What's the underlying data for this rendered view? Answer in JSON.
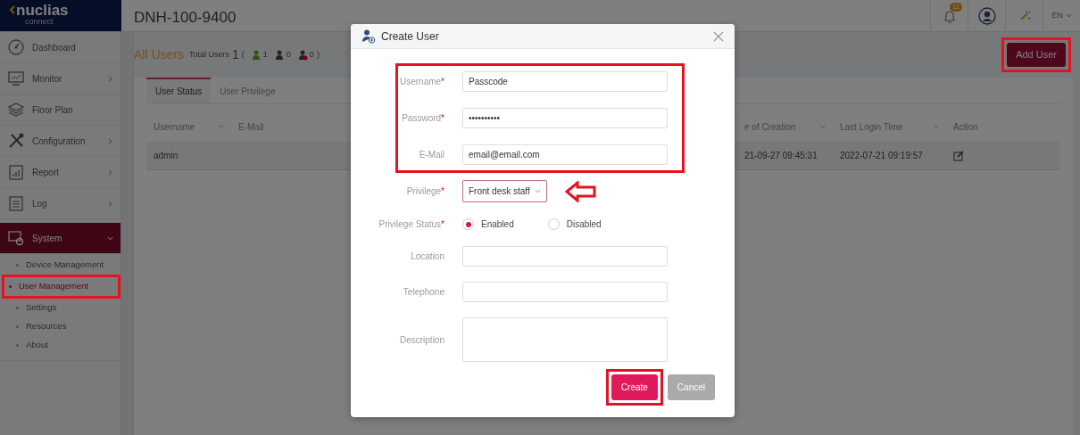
{
  "brand": {
    "name": "nuclias",
    "tagline": "connect"
  },
  "header": {
    "title": "DNH-100-9400",
    "notification_count": "11",
    "language": "EN"
  },
  "sidebar": {
    "items": [
      {
        "label": "Dashboard",
        "has_arrow": false,
        "expanded": false
      },
      {
        "label": "Monitor",
        "has_arrow": true,
        "expanded": false
      },
      {
        "label": "Floor Plan",
        "has_arrow": false,
        "expanded": false
      },
      {
        "label": "Configuration",
        "has_arrow": true,
        "expanded": false
      },
      {
        "label": "Report",
        "has_arrow": true,
        "expanded": false
      },
      {
        "label": "Log",
        "has_arrow": true,
        "expanded": false
      },
      {
        "label": "System",
        "has_arrow": true,
        "expanded": true,
        "children": [
          {
            "label": "Device Management",
            "selected": false,
            "highlighted": false
          },
          {
            "label": "User Management",
            "selected": true,
            "highlighted": true
          },
          {
            "label": "Settings",
            "selected": false,
            "highlighted": false
          },
          {
            "label": "Resources",
            "selected": false,
            "highlighted": false
          },
          {
            "label": "About",
            "selected": false,
            "highlighted": false
          }
        ]
      }
    ]
  },
  "page": {
    "title": "All Users",
    "total_label": "Total Users",
    "total": "1",
    "open_paren": "(",
    "close_paren": ")",
    "counts": [
      {
        "kind": "active",
        "value": "1"
      },
      {
        "kind": "inactive",
        "value": "0"
      },
      {
        "kind": "blocked",
        "value": "0"
      }
    ],
    "add_button": "Add User"
  },
  "tabs": [
    {
      "label": "User Status",
      "selected": true
    },
    {
      "label": "User Privilege",
      "selected": false
    }
  ],
  "table": {
    "columns": [
      {
        "label": "Username",
        "sortable": true
      },
      {
        "label": "E-Mail"
      },
      {
        "label": "e of Creation",
        "sortable": true
      },
      {
        "label": "Last Login Time",
        "sortable": true
      },
      {
        "label": "Action",
        "sortable": false
      }
    ],
    "rows": [
      {
        "cells": [
          "admin",
          "",
          "21-09-27 09:45:31",
          "2022-07-21 09:19:57"
        ]
      }
    ]
  },
  "modal": {
    "title": "Create User",
    "fields": [
      {
        "kind": "text",
        "label": "Username",
        "required_mark": "*",
        "value": "Passcode"
      },
      {
        "kind": "text",
        "label": "Password",
        "required_mark": "*",
        "value": "••••••••••"
      },
      {
        "kind": "text",
        "label": "E-Mail",
        "value": "email@email.com"
      },
      {
        "kind": "select",
        "label": "Privilege",
        "required_mark": "*",
        "value": "Front desk staff"
      },
      {
        "kind": "radio",
        "label": "Privilege Status",
        "required_mark": "*",
        "options": [
          {
            "label": "Enabled",
            "selected": true
          },
          {
            "label": "Disabled",
            "selected": false
          }
        ]
      },
      {
        "kind": "text",
        "label": "Location"
      },
      {
        "kind": "text",
        "label": "Telephone"
      },
      {
        "kind": "textarea",
        "label": "Description"
      }
    ],
    "buttons": [
      {
        "label": "Create",
        "kind": "primary"
      },
      {
        "label": "Cancel",
        "kind": "secondary"
      }
    ]
  }
}
